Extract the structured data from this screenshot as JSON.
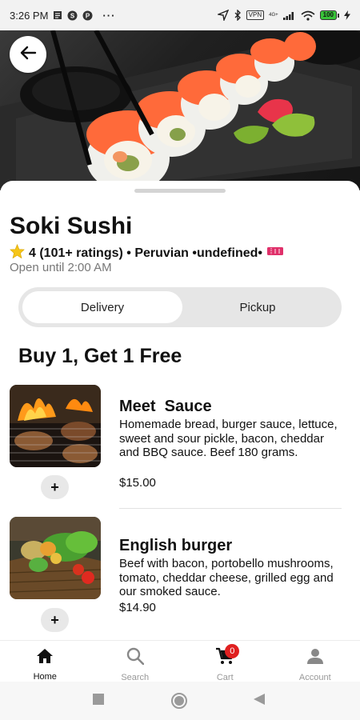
{
  "status_bar": {
    "time": "3:26 PM",
    "dots": "···",
    "vpn_label": "VPN",
    "network_label": "4G+",
    "battery_level": "100"
  },
  "restaurant": {
    "name": "Soki Sushi",
    "rating_icon": "star-icon",
    "meta": "4 (101+ ratings) • Peruvian •undefined•",
    "hours": "Open until 2:00 AM"
  },
  "order_mode": {
    "options": [
      "Delivery",
      "Pickup"
    ],
    "selected": "Delivery"
  },
  "section": {
    "title": "Buy 1, Get 1 Free"
  },
  "menu_items": [
    {
      "name": "Meet  Sauce",
      "description": "Homemade bread, burger sauce, lettuce, sweet and sour pickle, bacon, cheddar and BBQ sauce. Beef 180 grams.",
      "price": "$15.00",
      "add_label": "+"
    },
    {
      "name": "English burger",
      "description": "Beef with bacon, portobello mushrooms, tomato, cheddar cheese, grilled egg and our smoked sauce.",
      "price": "$14.90",
      "add_label": "+"
    }
  ],
  "bottom_nav": {
    "items": [
      {
        "label": "Home",
        "icon": "home-icon"
      },
      {
        "label": "Search",
        "icon": "search-icon"
      },
      {
        "label": "Cart",
        "icon": "cart-icon"
      },
      {
        "label": "Account",
        "icon": "account-icon"
      }
    ],
    "active": "Home",
    "cart_count": "0"
  },
  "colors": {
    "accent_red": "#e02020",
    "toggle_bg": "#e6e6e6",
    "muted_text": "#777777"
  }
}
